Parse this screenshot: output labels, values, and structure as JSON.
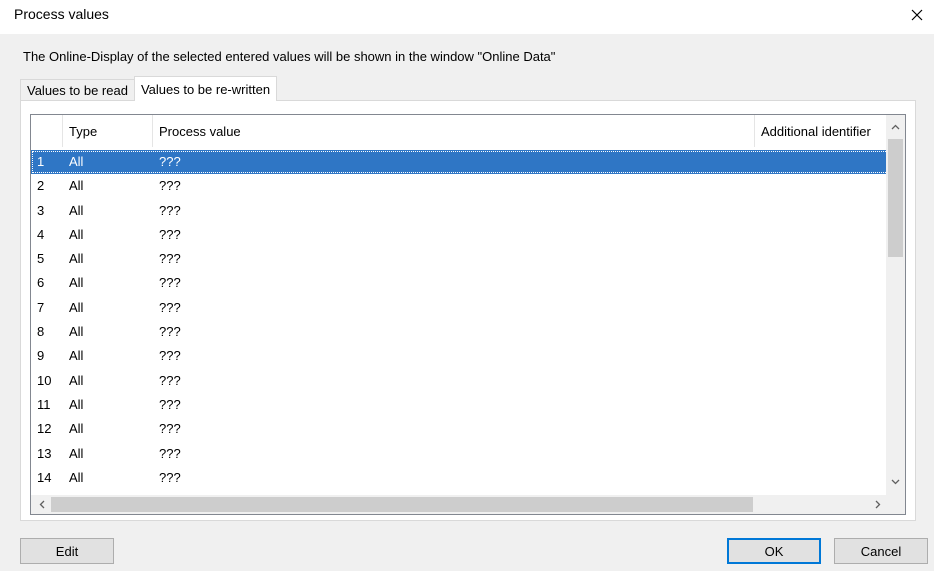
{
  "window": {
    "title": "Process values"
  },
  "info_text": "The Online-Display of the selected entered values will be shown in the window \"Online Data\"",
  "tabs": [
    {
      "label": "Values to be read",
      "active": false
    },
    {
      "label": "Values to be re-written",
      "active": true
    }
  ],
  "table": {
    "columns": [
      "",
      "Type",
      "Process value",
      "Additional identifier"
    ],
    "selected_row": 1,
    "rows": [
      {
        "num": "1",
        "type": "All",
        "value": "???"
      },
      {
        "num": "2",
        "type": "All",
        "value": "???"
      },
      {
        "num": "3",
        "type": "All",
        "value": "???"
      },
      {
        "num": "4",
        "type": "All",
        "value": "???"
      },
      {
        "num": "5",
        "type": "All",
        "value": "???"
      },
      {
        "num": "6",
        "type": "All",
        "value": "???"
      },
      {
        "num": "7",
        "type": "All",
        "value": "???"
      },
      {
        "num": "8",
        "type": "All",
        "value": "???"
      },
      {
        "num": "9",
        "type": "All",
        "value": "???"
      },
      {
        "num": "10",
        "type": "All",
        "value": "???"
      },
      {
        "num": "11",
        "type": "All",
        "value": "???"
      },
      {
        "num": "12",
        "type": "All",
        "value": "???"
      },
      {
        "num": "13",
        "type": "All",
        "value": "???"
      },
      {
        "num": "14",
        "type": "All",
        "value": "???"
      }
    ]
  },
  "buttons": {
    "edit": "Edit",
    "ok": "OK",
    "cancel": "Cancel"
  },
  "icons": {
    "close": "close-icon",
    "scroll_up": "chevron-up-icon",
    "scroll_down": "chevron-down-icon",
    "scroll_left": "chevron-left-icon",
    "scroll_right": "chevron-right-icon"
  },
  "colors": {
    "selection": "#2f76c5",
    "default_button_border": "#0078d7"
  }
}
